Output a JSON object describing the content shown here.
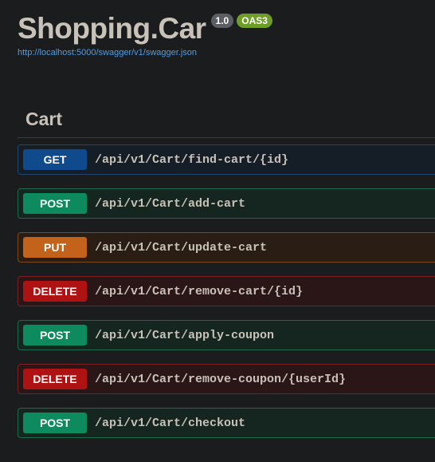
{
  "info": {
    "title": "Shopping.Car",
    "version": "1.0",
    "oas_badge": "OAS3",
    "spec_url": "http://localhost:5000/swagger/v1/swagger.json"
  },
  "tag": {
    "name": "Cart"
  },
  "operations": [
    {
      "method": "GET",
      "path": "/api/v1/Cart/find-cart/{id}"
    },
    {
      "method": "POST",
      "path": "/api/v1/Cart/add-cart"
    },
    {
      "method": "PUT",
      "path": "/api/v1/Cart/update-cart"
    },
    {
      "method": "DELETE",
      "path": "/api/v1/Cart/remove-cart/{id}"
    },
    {
      "method": "POST",
      "path": "/api/v1/Cart/apply-coupon"
    },
    {
      "method": "DELETE",
      "path": "/api/v1/Cart/remove-coupon/{userId}"
    },
    {
      "method": "POST",
      "path": "/api/v1/Cart/checkout"
    }
  ],
  "colors": {
    "background": "#1b1c1d",
    "get": "#0f4a8c",
    "post": "#0e8a5f",
    "put": "#c2621b",
    "delete": "#ae1212",
    "link": "#4e9ee6"
  }
}
